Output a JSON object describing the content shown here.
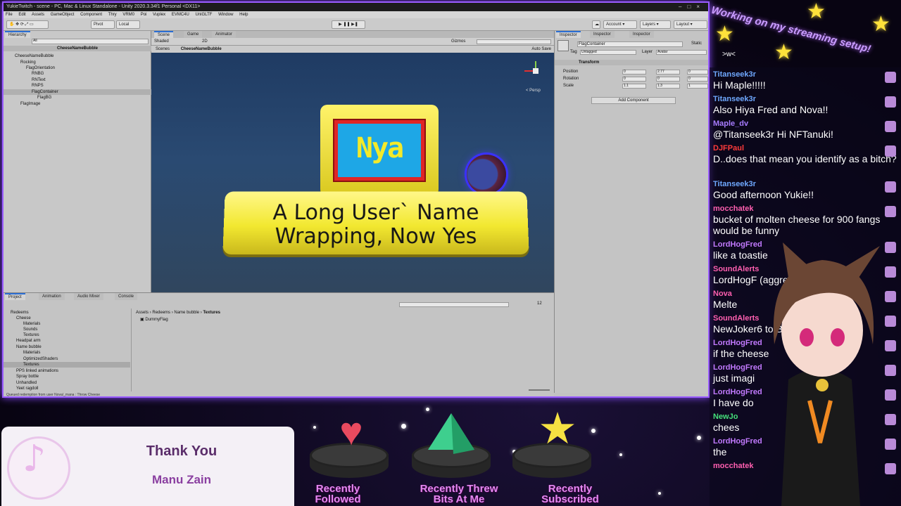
{
  "unity": {
    "title": "YukieTwitch - scene - PC, Mac & Linux Standalone - Unity 2020.3.34f1 Personal <DX11>",
    "menu": [
      "File",
      "Edit",
      "Assets",
      "GameObject",
      "Component",
      "Thry",
      "VRM0",
      "Poi",
      "Vuplex",
      "EVMC4U",
      "UniGLTF",
      "Window",
      "Help"
    ],
    "toolbar": {
      "pivot": "Pivot",
      "local": "Local",
      "account": "Account",
      "layers": "Layers",
      "layout": "Layout"
    },
    "hierarchy": {
      "tab": "Hierarchy",
      "search": "All",
      "root": "CheeseNameBubble",
      "items": [
        "CheeseNameBubble",
        "Rocking",
        "FlagOrientation",
        "RNBG",
        "RNText",
        "RNPS",
        "FlagContainer",
        "FlagBG",
        "FlagImage"
      ]
    },
    "scene": {
      "tabs": [
        "Scene",
        "Game",
        "Animator"
      ],
      "shading": "Shaded",
      "mode": "2D",
      "gizmos": "Gizmos",
      "crumb_scenes": "Scenes",
      "crumb_obj": "CheeseNameBubble",
      "autosave": "Auto Save",
      "persp": "< Persp",
      "plate_text_line1": "A Long User` Name",
      "plate_text_line2": "Wrapping, Now Yes",
      "flag_text": "Nya"
    },
    "inspector": {
      "tabs": [
        "Inspector",
        "Inspector",
        "Inspector"
      ],
      "object": "FlagContainer",
      "static": "Static",
      "tag_label": "Tag",
      "tag": "Untagged",
      "layer_label": "Layer",
      "layer": "Avatar",
      "transform": "Transform",
      "rows": [
        {
          "label": "Position",
          "x": "0",
          "y": "2.77",
          "z": "0"
        },
        {
          "label": "Rotation",
          "x": "0",
          "y": "0",
          "z": "0"
        },
        {
          "label": "Scale",
          "x": "1.1",
          "y": "1.3",
          "z": "1"
        }
      ],
      "add_component": "Add Component"
    },
    "project": {
      "tabs": [
        "Project",
        "Animation",
        "Audio Mixer",
        "Console"
      ],
      "crumbs": [
        "Assets",
        "Redeems",
        "Name bubble",
        "Textures"
      ],
      "tree": [
        "Redeems",
        "Cheese",
        "Materials",
        "Sounds",
        "Textures",
        "Headpat arm",
        "Name bubble",
        "Materials",
        "OptimizedShaders",
        "Textures",
        "PPS linked animations",
        "Spray bottle",
        "Unhandled",
        "Yeet ragdoll"
      ],
      "asset": "DummyFlag",
      "count": "12",
      "status": "Queued redemption from user Nova/_mana : Throw Cheese"
    }
  },
  "overlay": {
    "stream_title": "Working on my streaming setup!",
    "emote": ">w<",
    "now_playing": {
      "title": "Thank You",
      "artist": "Manu Zain"
    },
    "recent": [
      {
        "label_line1": "Recently",
        "label_line2": "Followed",
        "icon": "heart-icon",
        "color": "#e84a5f"
      },
      {
        "label_line1": "Recently Threw",
        "label_line2": "Bits At Me",
        "icon": "gem-icon",
        "color": "#3ecf8e"
      },
      {
        "label_line1": "Recently",
        "label_line2": "Subscribed",
        "icon": "star-icon",
        "color": "#f5e142"
      }
    ]
  },
  "chat": [
    {
      "name": "Titanseek3r",
      "color": "#6fa8ff",
      "text": "Hi Maple!!!!!"
    },
    {
      "name": "Titanseek3r",
      "color": "#6fa8ff",
      "text": "Also Hiya Fred and Nova!!"
    },
    {
      "name": "Maple_dv",
      "color": "#a77bff",
      "text": "@Titanseek3r Hi NFTanuki!"
    },
    {
      "name": "DJFPaul",
      "color": "#ff3b3b",
      "text": "D..does that mean you identify as a bitch?"
    },
    {
      "name": "Titanseek3r",
      "color": "#6fa8ff",
      "text": "Good afternoon Yukie!!"
    },
    {
      "name": "mocchatek",
      "color": "#ff5fb0",
      "text": "bucket of molten cheese for 900 fangs would be funny"
    },
    {
      "name": "LordHogFred",
      "color": "#c27aff",
      "text": "like a toastie"
    },
    {
      "name": "SoundAlerts",
      "color": "#ff5fb0",
      "text": "LordHogF (aggres"
    },
    {
      "name": "Nova",
      "color": "#ff5fb0",
      "text": "Melte"
    },
    {
      "name": "SoundAlerts",
      "color": "#ff5fb0",
      "text": "NewJoker6 to Bits!"
    },
    {
      "name": "LordHogFred",
      "color": "#c27aff",
      "text": "if the cheese"
    },
    {
      "name": "LordHogFred",
      "color": "#c27aff",
      "text": "just imagi"
    },
    {
      "name": "LordHogFred",
      "color": "#c27aff",
      "text": "I have do"
    },
    {
      "name": "NewJo",
      "color": "#44e07a",
      "text": "chees"
    },
    {
      "name": "LordHogFred",
      "color": "#c27aff",
      "text": "the"
    },
    {
      "name": "mocchatek",
      "color": "#ff5fb0",
      "text": ""
    }
  ]
}
